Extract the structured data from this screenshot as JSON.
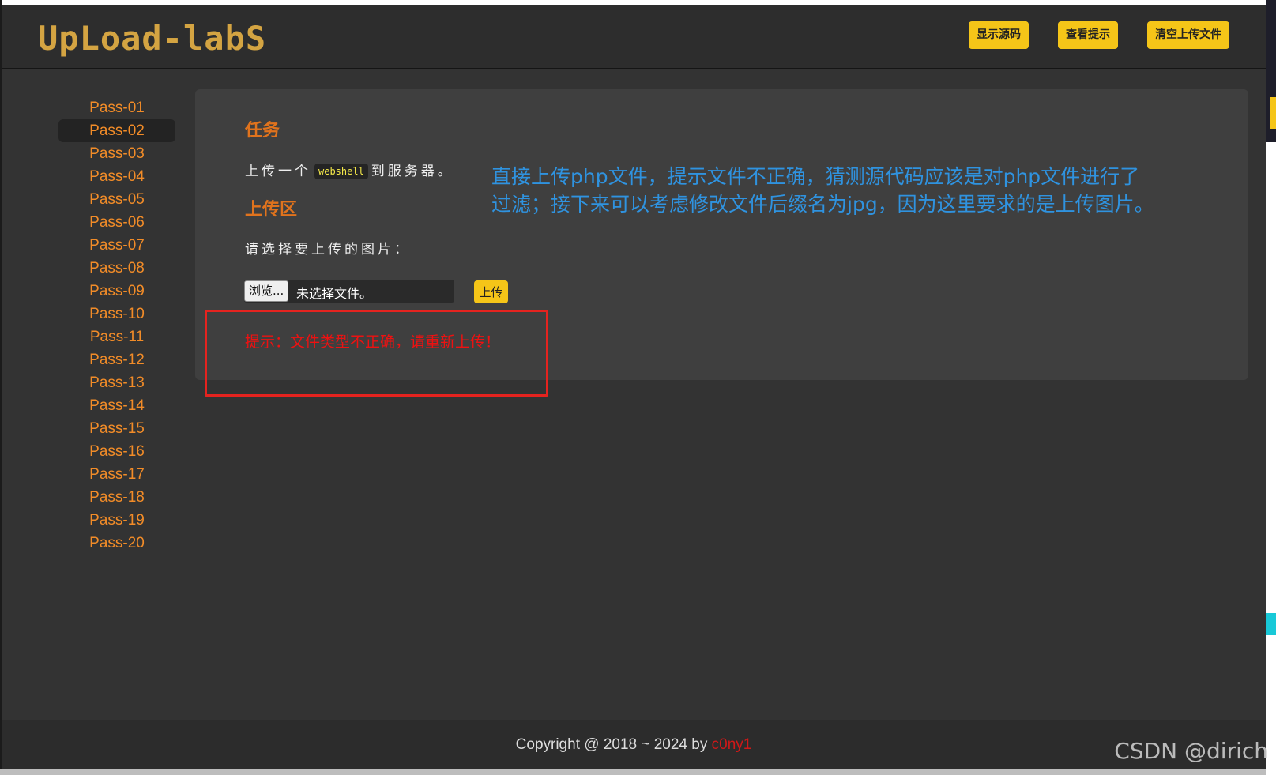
{
  "header": {
    "logo_text": "UpLoad-labS",
    "buttons": [
      "显示源码",
      "查看提示",
      "清空上传文件"
    ]
  },
  "sidebar": {
    "items": [
      "Pass-01",
      "Pass-02",
      "Pass-03",
      "Pass-04",
      "Pass-05",
      "Pass-06",
      "Pass-07",
      "Pass-08",
      "Pass-09",
      "Pass-10",
      "Pass-11",
      "Pass-12",
      "Pass-13",
      "Pass-14",
      "Pass-15",
      "Pass-16",
      "Pass-17",
      "Pass-18",
      "Pass-19",
      "Pass-20"
    ],
    "active": "Pass-02"
  },
  "main": {
    "task_heading": "任务",
    "task_prefix": "上传一个",
    "task_code": "webshell",
    "task_suffix": "到服务器。",
    "upload_heading": "上传区",
    "choose_label": "请选择要上传的图片：",
    "browse_label": "浏览...",
    "no_file_label": "未选择文件。",
    "upload_label": "上传",
    "error_message": "提示：文件类型不正确，请重新上传！"
  },
  "annotation": {
    "text": "直接上传php文件，提示文件不正确，猜测源代码应该是对php文件进行了过滤；接下来可以考虑修改文件后缀名为jpg，因为这里要求的是上传图片。",
    "color": "#2f93e0",
    "highlight_color": "#e5231f"
  },
  "footer": {
    "copyright": "Copyright @ 2018 ~ 2024 by",
    "author": "c0ny1"
  },
  "watermark": "CSDN @dirich",
  "colors": {
    "accent": "#f5c518",
    "sidebar_text": "#f28c28",
    "heading": "#e0731d",
    "error": "#ee1111"
  }
}
